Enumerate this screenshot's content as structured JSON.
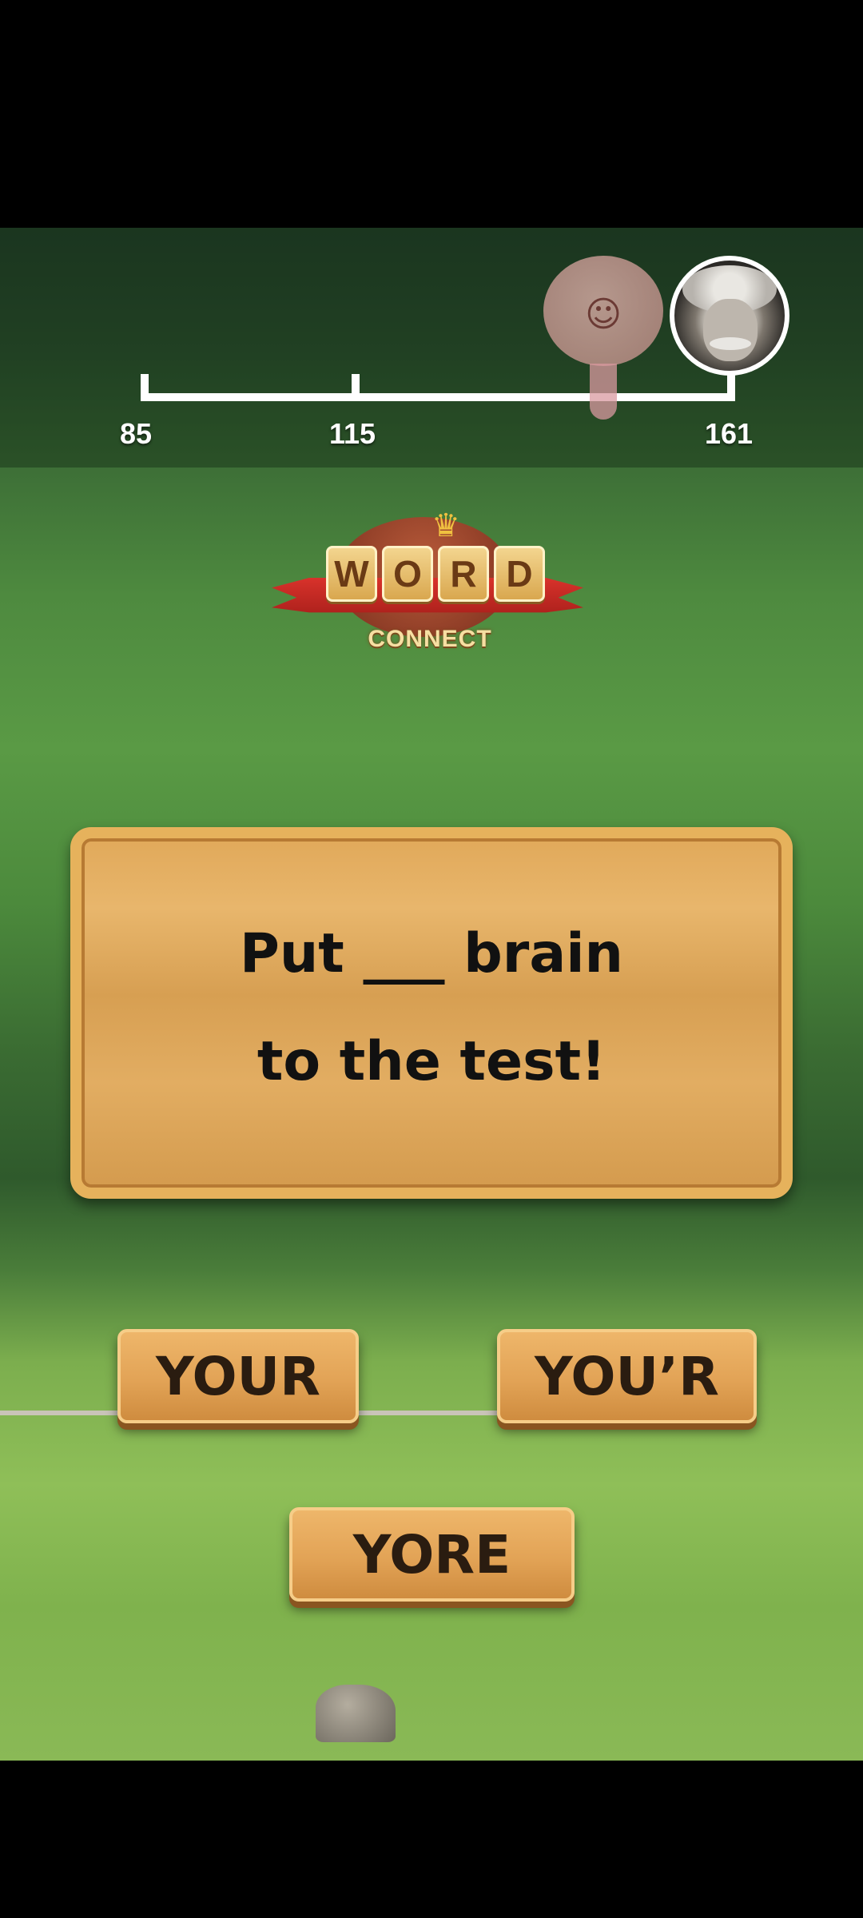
{
  "progress": {
    "ticks": [
      "85",
      "115",
      "161"
    ],
    "markers": [
      "brain-icon",
      "einstein-avatar"
    ]
  },
  "logo": {
    "letters": [
      "W",
      "O",
      "R",
      "D"
    ],
    "subtitle": "CONNECT"
  },
  "question": {
    "line1": "Put ___ brain",
    "line2": "to the test!"
  },
  "answers": [
    "YOUR",
    "YOU’R",
    "YORE"
  ],
  "colors": {
    "board": "#e1a95a",
    "button": "#e2a356",
    "ribbon": "#d8322b"
  }
}
